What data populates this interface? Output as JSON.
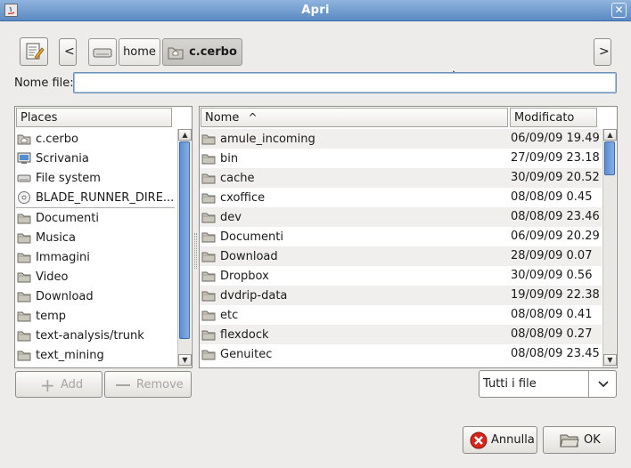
{
  "window": {
    "title": "Apri",
    "close_glyph": "✕"
  },
  "toolbar": {
    "edit_icon": "text-edit-icon",
    "back_label": "<",
    "forward_label": ">",
    "crumbs": [
      {
        "label": "home"
      },
      {
        "label": "c.cerbo"
      }
    ]
  },
  "filename": {
    "label": "Nome file:",
    "value": ""
  },
  "places": {
    "header": "Places",
    "items": [
      {
        "label": "c.cerbo",
        "icon": "home-folder-icon"
      },
      {
        "label": "Scrivania",
        "icon": "desktop-icon"
      },
      {
        "label": "File system",
        "icon": "drive-icon"
      },
      {
        "label": "BLADE_RUNNER_DIRE...",
        "icon": "disc-icon"
      },
      {
        "label": "Documenti",
        "icon": "folder-icon"
      },
      {
        "label": "Musica",
        "icon": "folder-icon"
      },
      {
        "label": "Immagini",
        "icon": "folder-icon"
      },
      {
        "label": "Video",
        "icon": "folder-icon"
      },
      {
        "label": "Download",
        "icon": "folder-icon"
      },
      {
        "label": "temp",
        "icon": "folder-icon"
      },
      {
        "label": "text-analysis/trunk",
        "icon": "folder-icon"
      },
      {
        "label": "text_mining",
        "icon": "folder-icon"
      }
    ],
    "add_label": "Add",
    "remove_label": "Remove"
  },
  "files": {
    "col_name": "Nome",
    "sort_glyph": "^",
    "col_modified": "Modificato",
    "rows": [
      {
        "name": "amule_incoming",
        "modified": "06/09/09 19.49"
      },
      {
        "name": "bin",
        "modified": "27/09/09 23.18"
      },
      {
        "name": "cache",
        "modified": "30/09/09 20.52"
      },
      {
        "name": "cxoffice",
        "modified": "08/08/09 0.45"
      },
      {
        "name": "dev",
        "modified": "08/08/09 23.46"
      },
      {
        "name": "Documenti",
        "modified": "06/09/09 20.29"
      },
      {
        "name": "Download",
        "modified": "28/09/09 0.07"
      },
      {
        "name": "Dropbox",
        "modified": "30/09/09 0.56"
      },
      {
        "name": "dvdrip-data",
        "modified": "19/09/09 22.38"
      },
      {
        "name": "etc",
        "modified": "08/08/09 0.41"
      },
      {
        "name": "flexdock",
        "modified": "08/08/09 0.27"
      },
      {
        "name": "Genuitec",
        "modified": "08/08/09 23.45"
      }
    ]
  },
  "filter": {
    "value": "Tutti i file"
  },
  "actions": {
    "cancel_label": "Annulla",
    "ok_label": "OK"
  },
  "colors": {
    "title_bar": "#6f98cc",
    "selection_thumb": "#5d8ed0",
    "folder": "#b8b4a8"
  }
}
